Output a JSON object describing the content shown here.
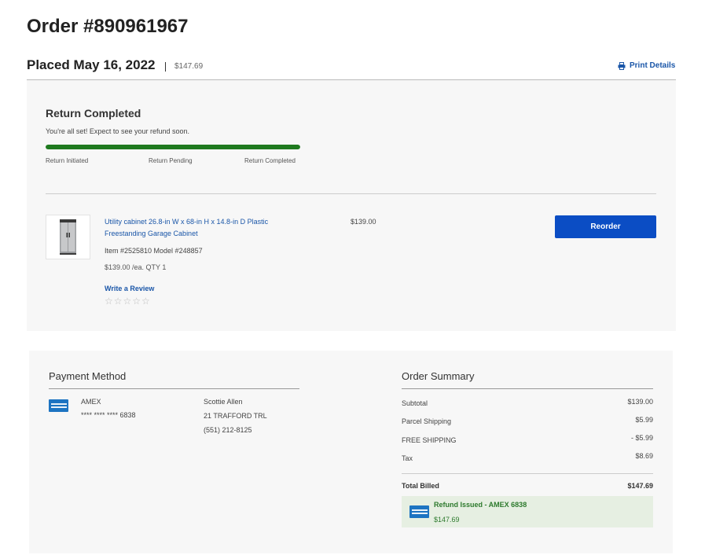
{
  "order": {
    "title": "Order #890961967",
    "placed": "Placed May 16, 2022",
    "total": "$147.69",
    "print_label": "Print Details"
  },
  "status": {
    "title": "Return Completed",
    "subtitle": "You're all set! Expect to see your refund soon.",
    "progress": 1.0,
    "progress_color": "#1f7a1f",
    "steps": [
      "Return Initiated",
      "Return Pending",
      "Return Completed"
    ]
  },
  "item": {
    "name": "Utility cabinet 26.8-in W x 68-in H x 14.8-in D Plastic Freestanding Garage Cabinet",
    "meta": "Item #2525810 Model #248857",
    "unit_price": "$139.00 /ea. QTY 1",
    "line_price": "$139.00",
    "write_review": "Write a Review",
    "stars": "☆☆☆☆☆",
    "reorder_label": "Reorder"
  },
  "payment": {
    "title": "Payment Method",
    "card_brand": "AMEX",
    "card_number": "**** **** **** 6838",
    "billing": [
      "Scottie Allen",
      "21 TRAFFORD TRL",
      "(551) 212-8125"
    ]
  },
  "summary": {
    "title": "Order Summary",
    "rows": [
      {
        "label": "Subtotal",
        "value": "$139.00"
      },
      {
        "label": "Parcel Shipping",
        "value": "$5.99"
      },
      {
        "label": "FREE SHIPPING",
        "value": "- $5.99"
      },
      {
        "label": "Tax",
        "value": "$8.69"
      }
    ],
    "total_label": "Total Billed",
    "total_value": "$147.69",
    "refund_title": "Refund Issued - AMEX 6838",
    "refund_amount": "$147.69"
  },
  "colors": {
    "link": "#1a56a8",
    "button": "#0b4dc4",
    "refund_bg": "#e6efe2",
    "refund_text": "#2d7a2d",
    "amex": "#1d74c2"
  }
}
